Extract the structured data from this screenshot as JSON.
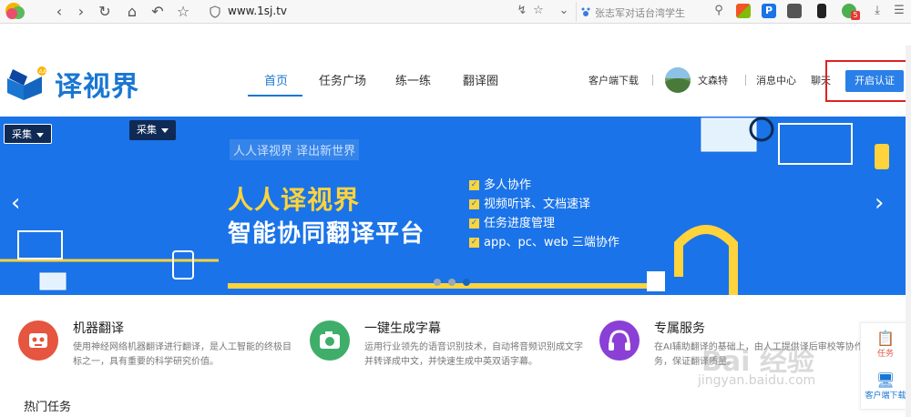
{
  "browser": {
    "url": "www.1sj.tv",
    "search_hint": "张志军对话台湾学生",
    "badge_count": "5",
    "icons": [
      "back-icon",
      "forward-icon",
      "reload-icon",
      "home-icon",
      "undo-icon",
      "star-icon",
      "shield-icon",
      "bolt-icon",
      "bookmark-icon",
      "chevron-down-icon",
      "search-icon",
      "grid-icon",
      "parking-icon",
      "evernote-icon",
      "bookmark-flag-icon",
      "user-badge-icon",
      "download-icon",
      "menu-icon"
    ]
  },
  "header": {
    "logo_text": "译视界",
    "nav": [
      {
        "label": "首页",
        "active": true
      },
      {
        "label": "任务广场",
        "active": false
      },
      {
        "label": "练一练",
        "active": false
      },
      {
        "label": "翻译圈",
        "active": false
      }
    ],
    "client_download": "客户端下载",
    "username": "文森特",
    "messages": "消息中心",
    "chat": "聊天",
    "cert_button": "开启认证"
  },
  "banner": {
    "caiji_1": "采集",
    "caiji_2": "采集",
    "subtitle": "人人译视界  译出新世界",
    "headline_1": "人人译视界",
    "headline_2": "智能协同翻译平台",
    "features": [
      "多人协作",
      "视频听译、文档速译",
      "任务进度管理",
      "app、pc、web 三端协作"
    ],
    "slide_count": 3,
    "active_slide": 3,
    "colors": {
      "bg": "#1a73e8",
      "accent": "#ffd33c"
    }
  },
  "services": [
    {
      "icon": "robot-icon",
      "color": "#e5553f",
      "title": "机器翻译",
      "desc": "使用神经网络机器翻译进行翻译，是人工智能的终极目标之一，具有重要的科学研究价值。"
    },
    {
      "icon": "camera-icon",
      "color": "#3fae6a",
      "title": "一键生成字幕",
      "desc": "运用行业领先的语音识别技术，自动将音频识别成文字并转译成中文，并快速生成中英双语字幕。"
    },
    {
      "icon": "headset-icon",
      "color": "#8a3fd6",
      "title": "专属服务",
      "desc": "在AI辅助翻译的基础上，由人工提供译后审校等协作服务，保证翻译质量。"
    }
  ],
  "hot_tasks": "热门任务",
  "side": {
    "tasks": "任务",
    "client": "客户端下载"
  },
  "watermark": {
    "main": "Bai 经验",
    "url": "jingyan.baidu.com"
  }
}
